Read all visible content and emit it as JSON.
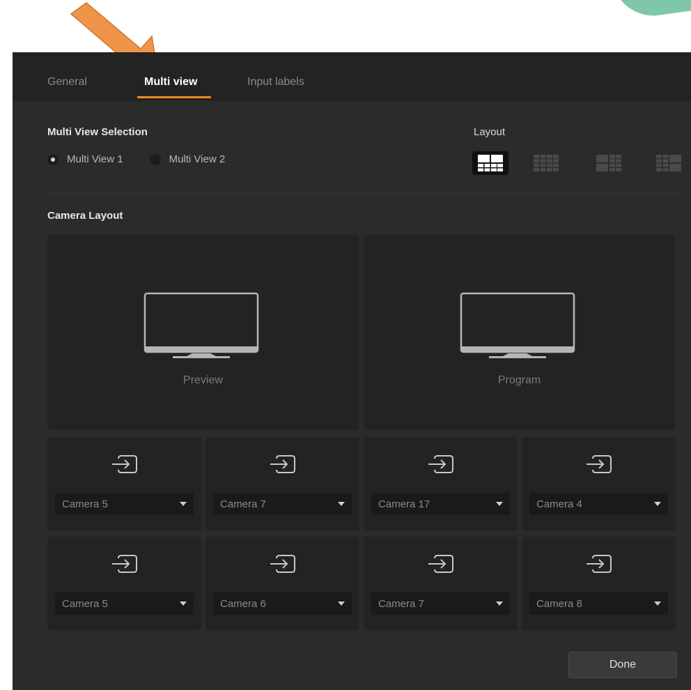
{
  "tabs": [
    {
      "label": "General",
      "active": false
    },
    {
      "label": "Multi view",
      "active": true
    },
    {
      "label": "Input labels",
      "active": false
    }
  ],
  "multi_view_selection": {
    "title": "Multi View Selection",
    "options": [
      {
        "label": "Multi View 1",
        "selected": true
      },
      {
        "label": "Multi View 2",
        "selected": false
      }
    ]
  },
  "layout": {
    "title": "Layout",
    "options": [
      {
        "icon": "layout-2-large-8-small-icon",
        "selected": true
      },
      {
        "icon": "layout-16-grid-icon",
        "selected": false
      },
      {
        "icon": "layout-large-left-icon",
        "selected": false
      },
      {
        "icon": "layout-large-right-icon",
        "selected": false
      }
    ]
  },
  "camera_layout": {
    "title": "Camera Layout",
    "preview_label": "Preview",
    "program_label": "Program",
    "row1": [
      "Camera 5",
      "Camera 7",
      "Camera 17",
      "Camera 4"
    ],
    "row2": [
      "Camera 5",
      "Camera 6",
      "Camera 7",
      "Camera 8"
    ]
  },
  "done_label": "Done",
  "colors": {
    "accent": "#f08a24",
    "arrow": "#f0944a",
    "background": "#2b2b2b",
    "tile": "#232323"
  }
}
